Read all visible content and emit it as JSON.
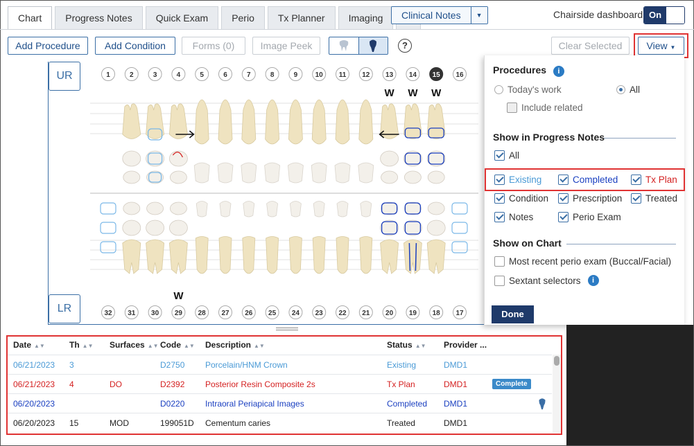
{
  "tabs": [
    {
      "label": "Chart",
      "active": true
    },
    {
      "label": "Progress Notes"
    },
    {
      "label": "Quick Exam"
    },
    {
      "label": "Perio"
    },
    {
      "label": "Tx Planner"
    },
    {
      "label": "Imaging"
    }
  ],
  "clinical_notes": "Clinical Notes",
  "chairside": {
    "label": "Chairside dashboard",
    "state": "On"
  },
  "toolbar": {
    "add_procedure": "Add Procedure",
    "add_condition": "Add Condition",
    "forms": "Forms (0)",
    "image_peek": "Image Peek",
    "clear_selected": "Clear Selected",
    "view": "View"
  },
  "chart": {
    "quad_ur": "UR",
    "quad_lr": "LR",
    "upper_teeth": [
      "1",
      "2",
      "3",
      "4",
      "5",
      "6",
      "7",
      "8",
      "9",
      "10",
      "11",
      "12",
      "13",
      "14",
      "15",
      "16"
    ],
    "lower_teeth": [
      "32",
      "31",
      "30",
      "29",
      "28",
      "27",
      "26",
      "25",
      "24",
      "23",
      "22",
      "21",
      "20",
      "19",
      "18",
      "17"
    ],
    "selected_tooth": "15",
    "w_mark": "W"
  },
  "panel": {
    "procedures": "Procedures",
    "todays_work": "Today's work",
    "all": "All",
    "include_related": "Include related",
    "show_in_progress": "Show in Progress Notes",
    "pn_all": "All",
    "existing": "Existing",
    "completed": "Completed",
    "tx_plan": "Tx Plan",
    "condition": "Condition",
    "prescription": "Prescription",
    "treated": "Treated",
    "notes": "Notes",
    "perio_exam": "Perio Exam",
    "show_on_chart": "Show on Chart",
    "recent_perio": "Most recent perio exam (Buccal/Facial)",
    "sextant": "Sextant selectors",
    "done": "Done"
  },
  "table": {
    "headers": {
      "date": "Date",
      "th": "Th",
      "surfaces": "Surfaces",
      "code": "Code",
      "description": "Description",
      "status": "Status",
      "provider": "Provider ..."
    },
    "rows": [
      {
        "date": "06/21/2023",
        "th": "3",
        "surfaces": "",
        "code": "D2750",
        "description": "Porcelain/HNM Crown",
        "status": "Existing",
        "provider": "DMD1",
        "color": "#4a9ad6"
      },
      {
        "date": "06/21/2023",
        "th": "4",
        "surfaces": "DO",
        "code": "D2392",
        "description": "Posterior Resin Composite 2s",
        "status": "Tx Plan",
        "provider": "DMD1",
        "color": "#d42020",
        "badge": "Complete"
      },
      {
        "date": "06/20/2023",
        "th": "",
        "surfaces": "",
        "code": "D0220",
        "description": "Intraoral Periapical Images",
        "status": "Completed",
        "provider": "DMD1",
        "color": "#1a3fc0",
        "tooth_icon": "tooth-icon"
      },
      {
        "date": "06/20/2023",
        "th": "15",
        "surfaces": "MOD",
        "code": "199051D",
        "description": "Cementum caries",
        "status": "Treated",
        "provider": "DMD1",
        "color": "#222"
      }
    ]
  }
}
